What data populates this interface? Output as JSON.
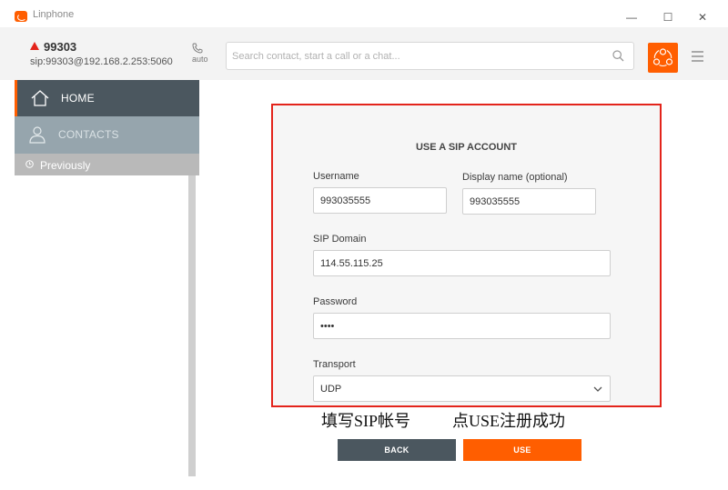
{
  "window": {
    "title": "Linphone",
    "minimize_glyph": "—",
    "maximize_glyph": "☐",
    "close_glyph": "✕"
  },
  "account": {
    "name": "99303",
    "sip": "sip:99303@192.168.2.253:5060",
    "mode": "auto",
    "status_color": "#e3241b"
  },
  "search": {
    "placeholder": "Search contact, start a call or a chat..."
  },
  "sidebar": {
    "home_label": "HOME",
    "contacts_label": "CONTACTS",
    "previously_label": "Previously"
  },
  "form": {
    "title": "USE A SIP ACCOUNT",
    "username_label": "Username",
    "username_value": "993035555",
    "display_name_label": "Display name (optional)",
    "display_name_value": "993035555",
    "sip_domain_label": "SIP Domain",
    "sip_domain_value": "114.55.115.25",
    "password_label": "Password",
    "password_value": "••••",
    "transport_label": "Transport",
    "transport_value": "UDP"
  },
  "annotations": {
    "left": "填写SIP帐号",
    "right": "点USE注册成功"
  },
  "buttons": {
    "back_label": "BACK",
    "use_label": "USE"
  },
  "colors": {
    "accent": "#ff5e00",
    "nav_dark": "#4b575f",
    "highlight_border": "#e3241b"
  }
}
